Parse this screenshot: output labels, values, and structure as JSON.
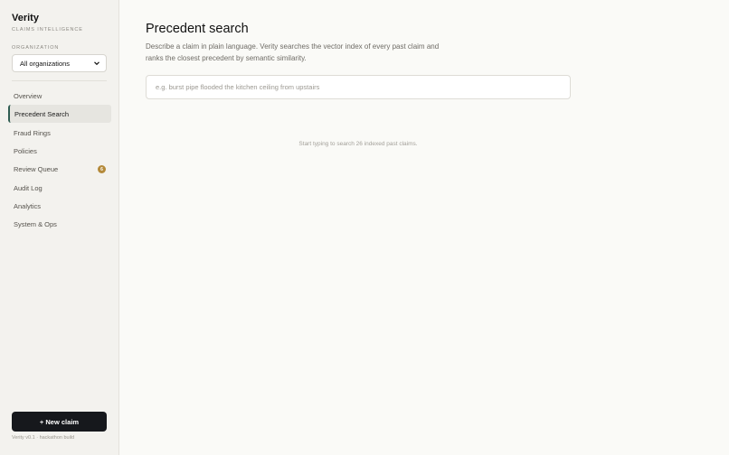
{
  "sidebar": {
    "brand_name": "Verity",
    "brand_subtitle": "CLAIMS INTELLIGENCE",
    "org_label": "ORGANIZATION",
    "org_selected": "All organizations",
    "nav": [
      {
        "label": "Overview"
      },
      {
        "label": "Precedent Search",
        "active": true
      },
      {
        "label": "Fraud Rings"
      },
      {
        "label": "Policies"
      },
      {
        "label": "Review Queue",
        "badge": "6"
      },
      {
        "label": "Audit Log"
      },
      {
        "label": "Analytics"
      },
      {
        "label": "System & Ops"
      }
    ],
    "new_claim_label": "+ New claim",
    "version_text": "Verity v0.1 · hackathon build"
  },
  "main": {
    "title": "Precedent search",
    "description": "Describe a claim in plain language. Verity searches the vector index of every past claim and ranks the closest precedent by semantic similarity.",
    "search_placeholder": "e.g. burst pipe flooded the kitchen ceiling from upstairs",
    "search_value": "",
    "empty_hint": "Start typing to search 26 indexed past claims."
  },
  "colors": {
    "sidebar_bg": "#f3f2ee",
    "main_bg": "#fafaf7",
    "accent": "#2f5d52",
    "badge": "#b48a3a",
    "button_bg": "#16181c"
  }
}
